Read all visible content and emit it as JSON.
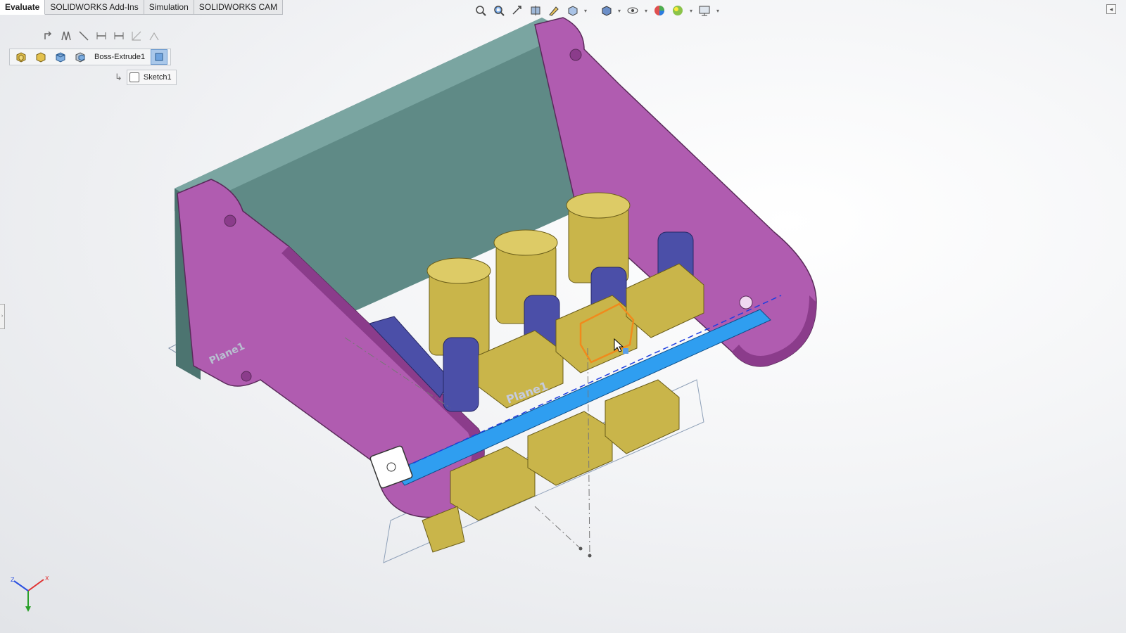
{
  "tabs": [
    {
      "label": "Evaluate",
      "active": true
    },
    {
      "label": "SOLIDWORKS Add-Ins",
      "active": false
    },
    {
      "label": "Simulation",
      "active": false
    },
    {
      "label": "SOLIDWORKS CAM",
      "active": false
    }
  ],
  "hud_toolbar": {
    "icons": [
      "zoom-to-fit-icon",
      "zoom-to-area-icon",
      "previous-view-icon",
      "section-view-icon",
      "dynamic-annotation-icon",
      "view-orientation-icon",
      "display-style-icon",
      "hide-show-items-icon",
      "edit-appearance-icon",
      "apply-scene-icon",
      "view-settings-icon"
    ]
  },
  "context_toolbar": {
    "icons": [
      "normal-to-icon",
      "sketch-icon-1",
      "line-icon",
      "smart-dimension-icon",
      "dimension-icon",
      "relations-icon",
      "trim-icon"
    ]
  },
  "breadcrumb": {
    "items": [
      "assembly-icon",
      "subassembly-icon",
      "part-icon",
      "component-icon"
    ],
    "feature": "Boss-Extrude1",
    "sub_item": "Sketch1"
  },
  "model": {
    "plane_labels": [
      "Plane1",
      "Plane1"
    ],
    "colors": {
      "frame": "#b05cb0",
      "frame_dark": "#8b3c8b",
      "back_plate": "#5f8a86",
      "brass": "#c9b54a",
      "brass_dark": "#9e8b2e",
      "bracket": "#4b4fa8",
      "rod": "#2f9ef0",
      "selection": "#f08a1c"
    }
  },
  "triad": {
    "x": "X",
    "y": "Y",
    "z": "Z"
  }
}
